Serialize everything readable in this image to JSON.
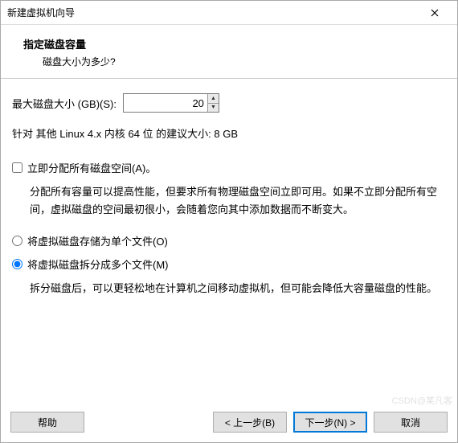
{
  "window": {
    "title": "新建虚拟机向导"
  },
  "header": {
    "title": "指定磁盘容量",
    "subtitle": "磁盘大小为多少?"
  },
  "disk_size": {
    "label": "最大磁盘大小 (GB)(S):",
    "value": "20",
    "recommended": "针对 其他 Linux 4.x 内核 64 位 的建议大小: 8 GB"
  },
  "allocate": {
    "label": "立即分配所有磁盘空间(A)。",
    "checked": false,
    "description": "分配所有容量可以提高性能，但要求所有物理磁盘空间立即可用。如果不立即分配所有空间，虚拟磁盘的空间最初很小，会随着您向其中添加数据而不断变大。"
  },
  "storage": {
    "single_label": "将虚拟磁盘存储为单个文件(O)",
    "split_label": "将虚拟磁盘拆分成多个文件(M)",
    "split_description": "拆分磁盘后，可以更轻松地在计算机之间移动虚拟机，但可能会降低大容量磁盘的性能。"
  },
  "footer": {
    "help": "帮助",
    "back": "< 上一步(B)",
    "next": "下一步(N) >",
    "cancel": "取消"
  },
  "watermark": "CSDN@某凡客"
}
